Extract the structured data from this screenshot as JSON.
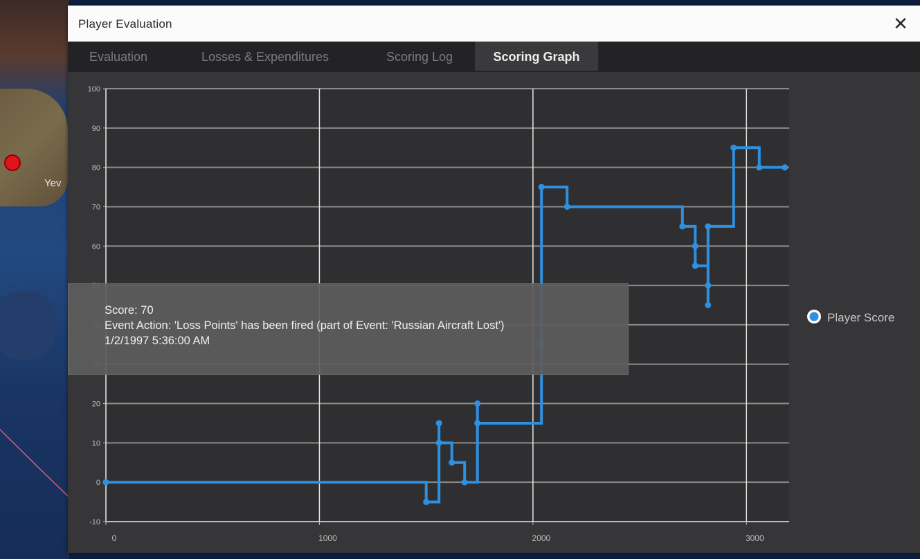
{
  "map": {
    "place_label": "Yev"
  },
  "window": {
    "title": "Player Evaluation",
    "close_glyph": "✕"
  },
  "tabs": [
    {
      "label": "Evaluation",
      "active": false
    },
    {
      "label": "Losses & Expenditures",
      "active": false
    },
    {
      "label": "Scoring Log",
      "active": false
    },
    {
      "label": "Scoring Graph",
      "active": true
    }
  ],
  "tooltip": {
    "score_line": "Score: 70",
    "event_line": "Event Action: 'Loss Points' has been fired (part of Event: 'Russian Aircraft Lost')",
    "time_line": "1/2/1997 5:36:00 AM"
  },
  "colors": {
    "series": "#2e90e0",
    "grid": "#8c8c8c",
    "vgrid": "#e6e6e6"
  },
  "chart_data": {
    "type": "line",
    "step": true,
    "series": [
      {
        "name": "Player Score",
        "points": [
          [
            0,
            0
          ],
          [
            1500,
            0
          ],
          [
            1500,
            -5
          ],
          [
            1560,
            -5
          ],
          [
            1560,
            15
          ],
          [
            1560,
            10
          ],
          [
            1620,
            10
          ],
          [
            1620,
            5
          ],
          [
            1680,
            5
          ],
          [
            1680,
            0
          ],
          [
            1740,
            0
          ],
          [
            1740,
            20
          ],
          [
            1740,
            15
          ],
          [
            2040,
            15
          ],
          [
            2040,
            35
          ],
          [
            2040,
            75
          ],
          [
            2160,
            75
          ],
          [
            2160,
            70
          ],
          [
            2700,
            70
          ],
          [
            2700,
            65
          ],
          [
            2760,
            65
          ],
          [
            2760,
            60
          ],
          [
            2760,
            55
          ],
          [
            2820,
            55
          ],
          [
            2820,
            50
          ],
          [
            2820,
            45
          ],
          [
            2820,
            65
          ],
          [
            2940,
            65
          ],
          [
            2940,
            85
          ],
          [
            3060,
            85
          ],
          [
            3060,
            80
          ],
          [
            3180,
            80
          ]
        ],
        "markers": [
          [
            0,
            0
          ],
          [
            1500,
            -5
          ],
          [
            1560,
            15
          ],
          [
            1560,
            10
          ],
          [
            1620,
            5
          ],
          [
            1680,
            0
          ],
          [
            1740,
            20
          ],
          [
            1740,
            15
          ],
          [
            2040,
            35
          ],
          [
            2040,
            75
          ],
          [
            2160,
            70
          ],
          [
            2700,
            65
          ],
          [
            2760,
            60
          ],
          [
            2760,
            55
          ],
          [
            2820,
            50
          ],
          [
            2820,
            45
          ],
          [
            2820,
            65
          ],
          [
            2940,
            85
          ],
          [
            3060,
            80
          ],
          [
            3180,
            80
          ]
        ]
      }
    ],
    "xlim": [
      0,
      3200
    ],
    "ylim": [
      -10,
      100
    ],
    "xticks": [
      "0",
      "1000",
      "2000",
      "3000"
    ],
    "xtick_values": [
      0,
      1000,
      2000,
      3000
    ],
    "yticks": [
      "-10",
      "0",
      "10",
      "20",
      "30",
      "40",
      "50",
      "60",
      "70",
      "80",
      "90",
      "100"
    ],
    "ytick_values": [
      -10,
      0,
      10,
      20,
      30,
      40,
      50,
      60,
      70,
      80,
      90,
      100
    ],
    "grid": true,
    "legend": "right"
  }
}
